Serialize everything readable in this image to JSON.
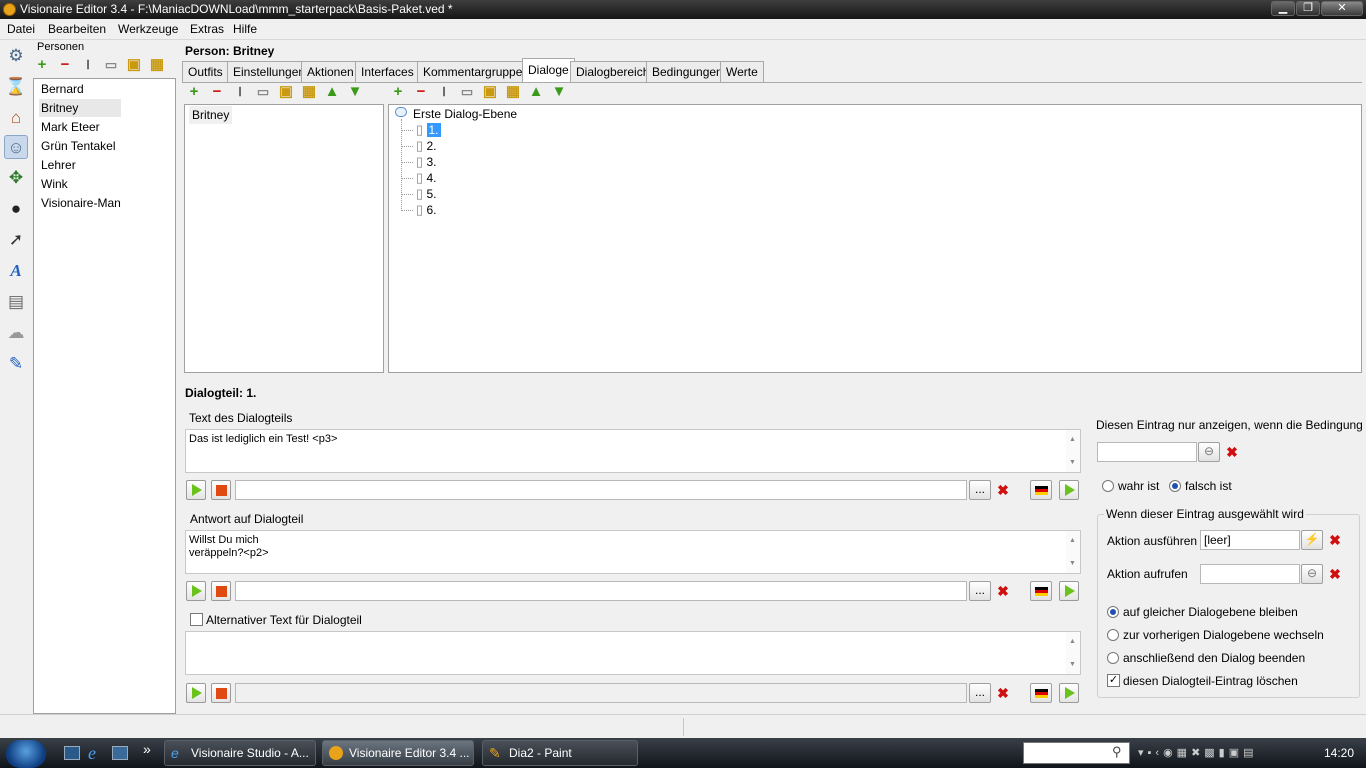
{
  "window": {
    "title": "Visionaire Editor 3.4 - F:\\ManiacDOWNLoad\\mmm_starterpack\\Basis-Paket.ved *",
    "min": "▁",
    "max": "❐",
    "close": "✕"
  },
  "menu": [
    "Datei",
    "Bearbeiten",
    "Werkzeuge",
    "Extras",
    "Hilfe"
  ],
  "persons_panel": {
    "label": "Personen",
    "items": [
      "Bernard",
      "Britney",
      "Mark Eteer",
      "Grün Tentakel",
      "Lehrer",
      "Wink",
      "Visionaire-Man"
    ],
    "selected": "Britney"
  },
  "person_header": "Person: Britney",
  "tabs": [
    "Outfits",
    "Einstellungen",
    "Aktionen",
    "Interfaces",
    "Kommentargruppen",
    "Dialoge",
    "Dialogbereich",
    "Bedingungen",
    "Werte"
  ],
  "active_tab": "Dialoge",
  "dialog_list": [
    "Britney"
  ],
  "dialog_tree": {
    "root": "Erste Dialog-Ebene",
    "children": [
      "1.",
      "2.",
      "3.",
      "4.",
      "5.",
      "6."
    ],
    "selected": "1."
  },
  "dialog_part": {
    "title": "Dialogteil: 1.",
    "text_label": "Text des Dialogteils",
    "text_value": "Das ist lediglich ein Test! <p3>",
    "answer_label": "Antwort auf Dialogteil",
    "answer_line1": "Willst Du mich",
    "answer_line2": "veräppeln?<p2>",
    "alt_label": "Alternativer Text für Dialogteil",
    "alt_checked": false,
    "ellipsis": "..."
  },
  "condition": {
    "label": "Diesen Eintrag nur anzeigen, wenn die Bedingung",
    "true_label": "wahr ist",
    "false_label": "falsch ist",
    "selected": "falsch ist"
  },
  "selected_group": {
    "label": "Wenn dieser Eintrag ausgewählt wird",
    "run_action_label": "Aktion ausführen",
    "run_action_value": "[leer]",
    "call_action_label": "Aktion aufrufen",
    "options": [
      "auf gleicher Dialogebene bleiben",
      "zur vorherigen Dialogebene wechseln",
      "anschließend den Dialog beenden"
    ],
    "selected_option": "auf gleicher Dialogebene bleiben",
    "delete_label": "diesen Dialogteil-Eintrag löschen",
    "delete_checked": true
  },
  "taskbar": {
    "more": "»",
    "tasks": [
      "Visionaire Studio - A...",
      "Visionaire Editor 3.4 ...",
      "Dia2 - Paint"
    ],
    "active_task": "Visionaire Editor 3.4 ...",
    "clock": "14:20"
  },
  "colors": {
    "accent_selection": "#3399ff",
    "play_green": "#6ac21c",
    "stop_orange": "#e04a10",
    "delete_red": "#d01010"
  }
}
